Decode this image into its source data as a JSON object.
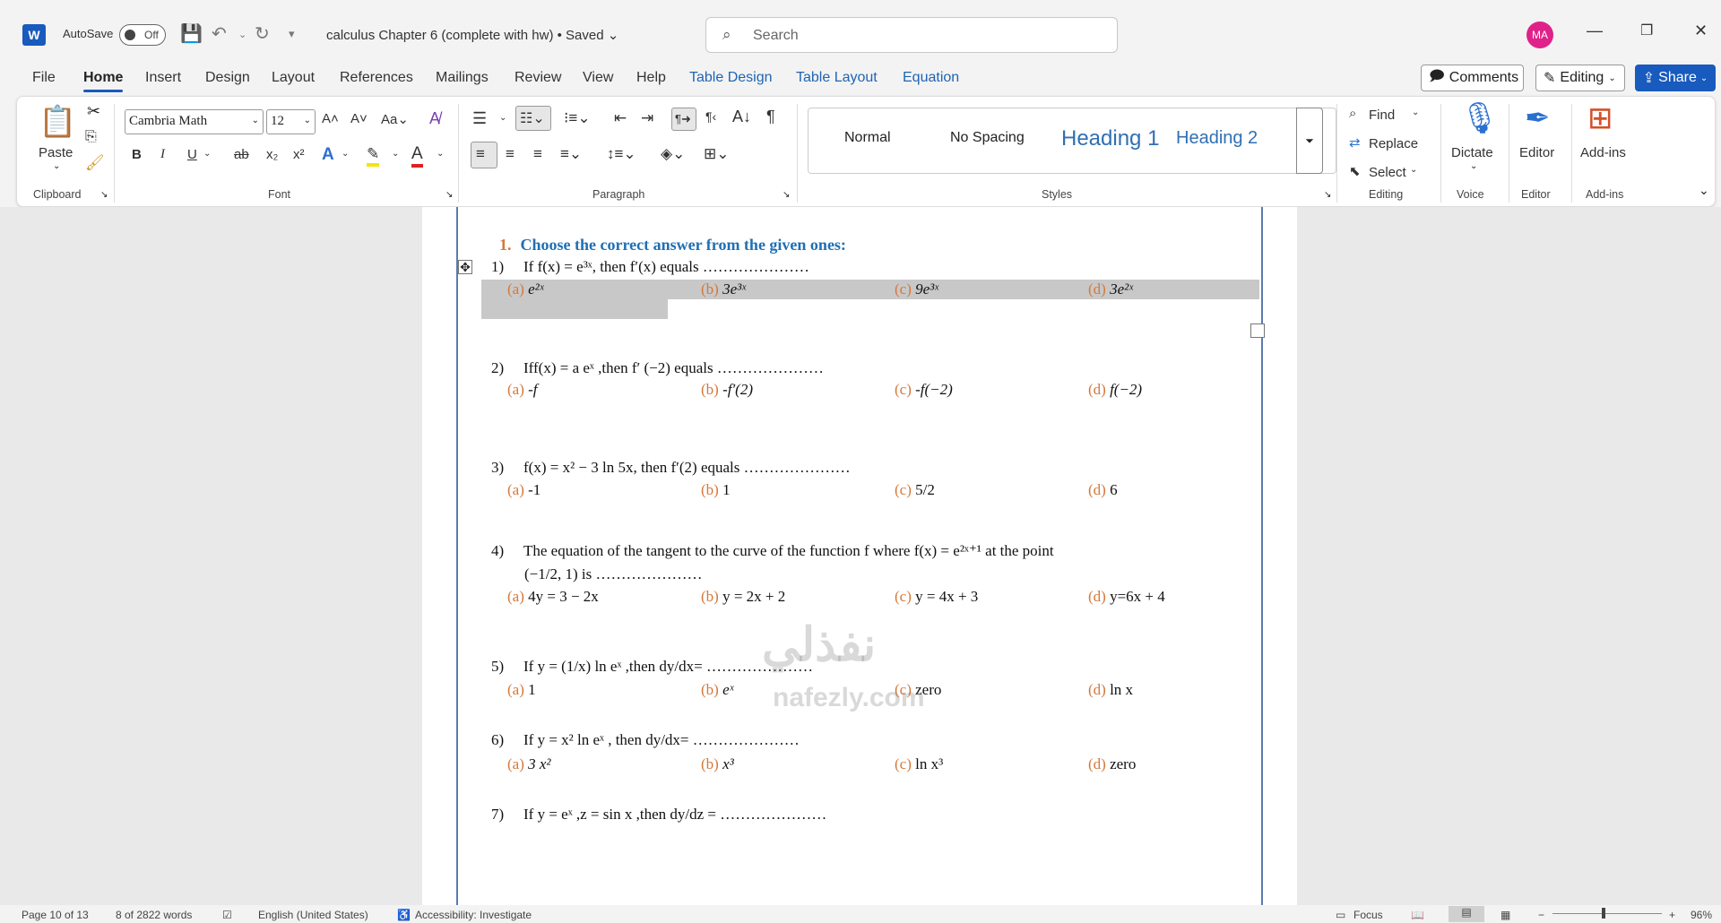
{
  "titlebar": {
    "autosave_label": "AutoSave",
    "autosave_state": "Off",
    "doc_title": "calculus Chapter 6 (complete with hw) • Saved ⌄",
    "search_placeholder": "Search",
    "avatar_initials": "MA"
  },
  "menu": {
    "tabs": [
      "File",
      "Home",
      "Insert",
      "Design",
      "Layout",
      "References",
      "Mailings",
      "Review",
      "View",
      "Help",
      "Table Design",
      "Table Layout",
      "Equation"
    ],
    "comments_label": "Comments",
    "editing_label": "Editing",
    "share_label": "Share"
  },
  "ribbon": {
    "clipboard": {
      "paste_label": "Paste",
      "group_label": "Clipboard"
    },
    "font": {
      "font_name": "Cambria Math",
      "font_size": "12",
      "group_label": "Font"
    },
    "paragraph": {
      "group_label": "Paragraph"
    },
    "styles": {
      "items": [
        "Normal",
        "No Spacing",
        "Heading 1",
        "Heading 2"
      ],
      "group_label": "Styles"
    },
    "editing": {
      "find": "Find",
      "replace": "Replace",
      "select": "Select",
      "group_label": "Editing"
    },
    "voice": {
      "dictate": "Dictate",
      "group_label": "Voice"
    },
    "editor": {
      "label": "Editor",
      "group_label": "Editor"
    },
    "addins": {
      "label": "Add-ins",
      "group_label": "Add-ins"
    }
  },
  "document": {
    "heading_num": "1.",
    "heading": "Choose the correct answer from the given ones:",
    "questions": [
      {
        "num": "1)",
        "text": "If f(x) =  e³ˣ, then f′(x) equals …………………",
        "options": [
          "(a)",
          "e²ˣ",
          "(b)",
          "3e³ˣ",
          "(c)",
          "9e³ˣ",
          "(d)",
          "3e²ˣ"
        ]
      },
      {
        "num": "2)",
        "text": "Iff(x) = a eˣ ,then f′ (−2) equals …………………",
        "options": [
          "(a)",
          "-f",
          "(b)",
          "-f′(2)",
          "(c)",
          "-f(−2)",
          "(d)",
          "f(−2)"
        ]
      },
      {
        "num": "3)",
        "text": "f(x) = x² − 3 ln 5x, then f′(2) equals …………………",
        "options": [
          "(a)",
          "-1",
          "(b)",
          "1",
          "(c)",
          "5/2",
          "(d)",
          "6"
        ]
      },
      {
        "num": "4)",
        "text": "The equation of the tangent to the curve of the function f where f(x) =  e²ˣ⁺¹ at the          point",
        "text2": "(−1/2, 1) is …………………",
        "options": [
          "(a)",
          "4y = 3 −  2x",
          "(b)",
          "y = 2x + 2",
          "(c)",
          "y = 4x + 3",
          "(d)",
          "y=6x + 4"
        ]
      },
      {
        "num": "5)",
        "text": "If y = (1/x) ln eˣ ,then dy/dx= …………………",
        "options": [
          "(a)",
          "1",
          "(b)",
          "eˣ",
          "(c)",
          "zero",
          "(d)",
          "ln x"
        ]
      },
      {
        "num": "6)",
        "text": "If y = x² ln eˣ , then dy/dx= …………………",
        "options": [
          "(a)",
          "3 x²",
          "(b)",
          "x³",
          "(c)",
          "ln x³",
          "(d)",
          "zero"
        ]
      },
      {
        "num": "7)",
        "text": "If y = eˣ ,z = sin x ,then dy/dz = …………………"
      }
    ]
  },
  "watermark": {
    "line1": "نفذلي",
    "line2": "nafezly.com"
  },
  "status": {
    "page": "Page 10 of 13",
    "words": "8 of 2822 words",
    "language": "English (United States)",
    "accessibility": "Accessibility: Investigate",
    "focus": "Focus",
    "zoom": "96%"
  }
}
